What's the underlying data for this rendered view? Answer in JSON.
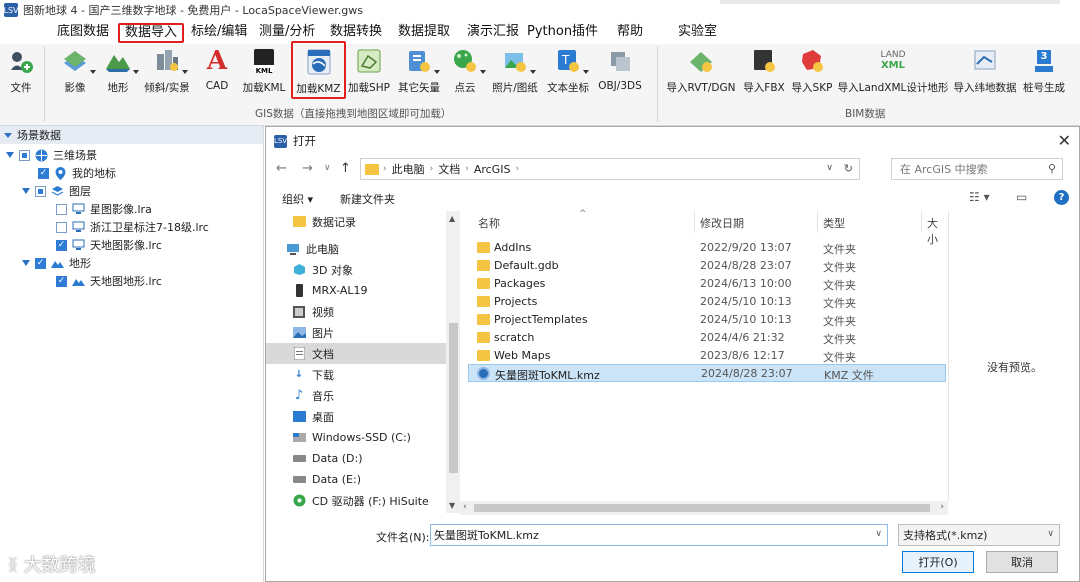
{
  "window": {
    "title": "图新地球 4 - 国产三维数字地球 - 免费用户 - LocaSpaceViewer.gws",
    "icon": "LSV"
  },
  "menu": [
    "底图数据",
    "数据导入",
    "标绘/编辑",
    "测量/分析",
    "数据转换",
    "数据提取",
    "演示汇报",
    "Python插件",
    "帮助",
    "实验室"
  ],
  "ribbon": {
    "file": "文件",
    "gis_buttons": [
      "影像",
      "地形",
      "倾斜/实景",
      "CAD",
      "加载KML",
      "加载KMZ",
      "加载SHP",
      "其它矢量",
      "点云",
      "照片/图纸",
      "文本坐标",
      "OBJ/3DS"
    ],
    "gis_group_label": "GIS数据（直接拖拽到地图区域即可加载）",
    "bim_buttons": [
      "导入RVT/DGN",
      "导入FBX",
      "导入SKP",
      "导入LandXML设计地形",
      "导入纬地数据",
      "桩号生成"
    ],
    "bim_group_label": "BIM数据",
    "landxml_icon_text": [
      "LAND",
      "XML"
    ],
    "cad_icon_text": "A",
    "kml_icon_text": "KML",
    "kmz_icon_text": "KML",
    "stake_icon_text": "3"
  },
  "scene_panel": {
    "header": "场景数据",
    "tree": [
      {
        "label": "三维场景"
      },
      {
        "label": "我的地标"
      },
      {
        "label": "图层"
      },
      {
        "label": "星图影像.lra"
      },
      {
        "label": "浙江卫星标注7-18级.lrc"
      },
      {
        "label": "天地图影像.lrc"
      },
      {
        "label": "地形"
      },
      {
        "label": "天地图地形.lrc"
      }
    ]
  },
  "dialog": {
    "title": "打开",
    "close": "✕",
    "breadcrumb": [
      "此电脑",
      "文档",
      "ArcGIS"
    ],
    "search_placeholder": "在 ArcGIS 中搜索",
    "organize": "组织 ▾",
    "new_folder": "新建文件夹",
    "nav_items": [
      "数据记录",
      "此电脑",
      "3D 对象",
      "MRX-AL19",
      "视频",
      "图片",
      "文档",
      "下载",
      "音乐",
      "桌面",
      "Windows-SSD (C:)",
      "Data (D:)",
      "Data (E:)",
      "CD 驱动器 (F:) HiSuite"
    ],
    "columns": [
      "名称",
      "修改日期",
      "类型",
      "大小"
    ],
    "files": [
      {
        "name": "AddIns",
        "date": "2022/9/20 13:07",
        "type": "文件夹"
      },
      {
        "name": "Default.gdb",
        "date": "2024/8/28 23:07",
        "type": "文件夹"
      },
      {
        "name": "Packages",
        "date": "2024/6/13 10:00",
        "type": "文件夹"
      },
      {
        "name": "Projects",
        "date": "2024/5/10 10:13",
        "type": "文件夹"
      },
      {
        "name": "ProjectTemplates",
        "date": "2024/5/10 10:13",
        "type": "文件夹"
      },
      {
        "name": "scratch",
        "date": "2024/4/6 21:32",
        "type": "文件夹"
      },
      {
        "name": "Web Maps",
        "date": "2023/8/6 12:17",
        "type": "文件夹"
      },
      {
        "name": "矢量图斑ToKML.kmz",
        "date": "2024/8/28 23:07",
        "type": "KMZ 文件"
      }
    ],
    "preview_text": "没有预览。",
    "filename_label": "文件名(N):",
    "filename_value": "矢量图斑ToKML.kmz",
    "filter": "支持格式(*.kmz)",
    "open_btn": "打开(O)",
    "cancel_btn": "取消"
  },
  "watermark": "大数跨境",
  "colors": {
    "accent": "#1f6fc5",
    "highlight": "#e02020",
    "selection": "#cce4f7"
  }
}
